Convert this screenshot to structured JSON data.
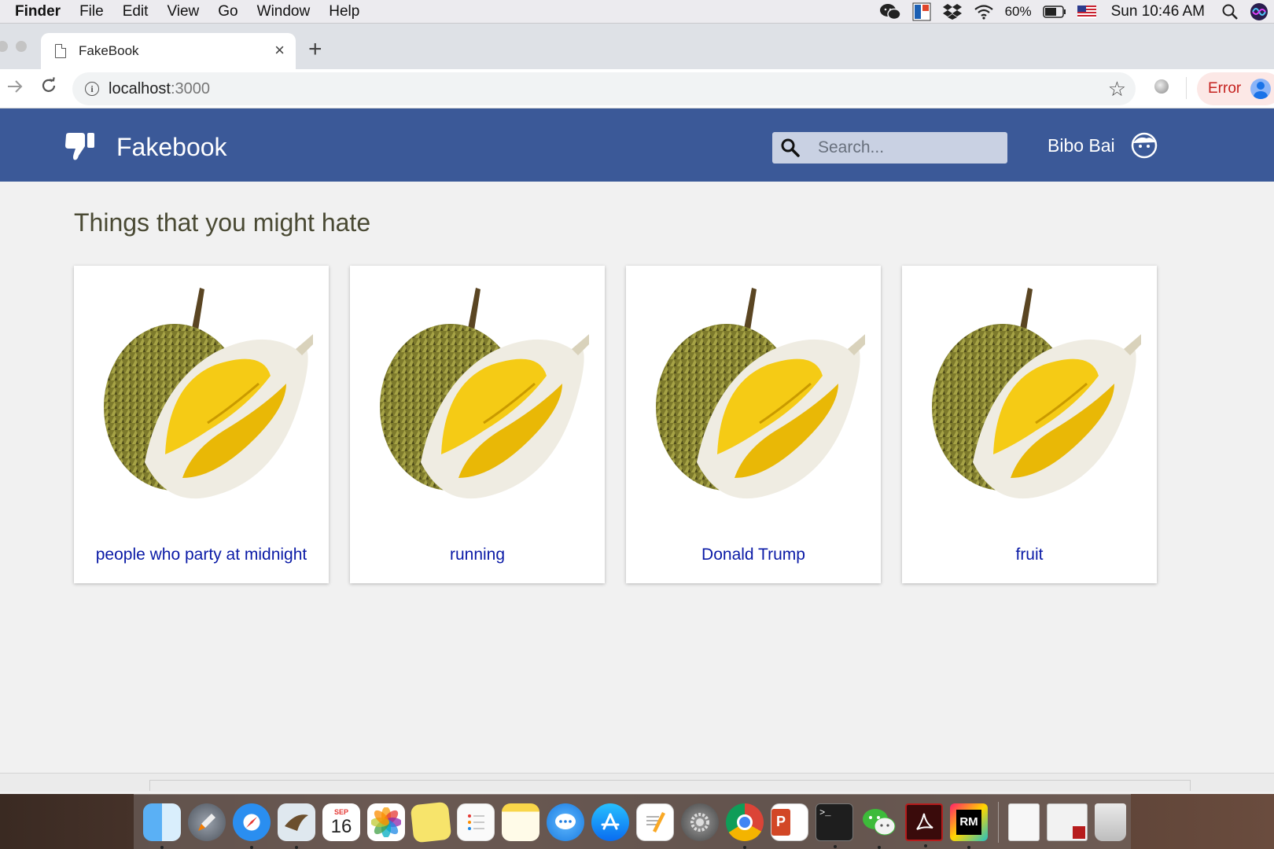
{
  "menubar": {
    "items": [
      "Finder",
      "File",
      "Edit",
      "View",
      "Go",
      "Window",
      "Help"
    ],
    "battery": "60%",
    "clock": "Sun 10:46 AM",
    "status_icons": [
      "wechat-icon",
      "app-icon",
      "dropbox-icon",
      "wifi-icon",
      "battery-icon",
      "us-flag-icon",
      "spotlight-icon",
      "siri-icon"
    ]
  },
  "browser": {
    "tab_title": "FakeBook",
    "tab_close": "×",
    "new_tab": "+",
    "url_host": "localhost",
    "url_port": ":3000",
    "profile_status": "Error"
  },
  "fakebook": {
    "brand": "Fakebook",
    "search_placeholder": "Search...",
    "user_name": "Bibo Bai",
    "section_title": "Things that you might hate",
    "colors": {
      "header": "#3b5998",
      "link": "#0a1aa6"
    },
    "cards": [
      {
        "label": "people who party at midnight",
        "image": "durian-image"
      },
      {
        "label": "running",
        "image": "durian-image"
      },
      {
        "label": "Donald Trump",
        "image": "durian-image"
      },
      {
        "label": "fruit",
        "image": "durian-image"
      }
    ]
  },
  "dock": {
    "calendar_month": "SEP",
    "calendar_day": "16",
    "powerpoint_letter": "P",
    "terminal_prompt": ">_",
    "rubymine_label": "RM"
  }
}
